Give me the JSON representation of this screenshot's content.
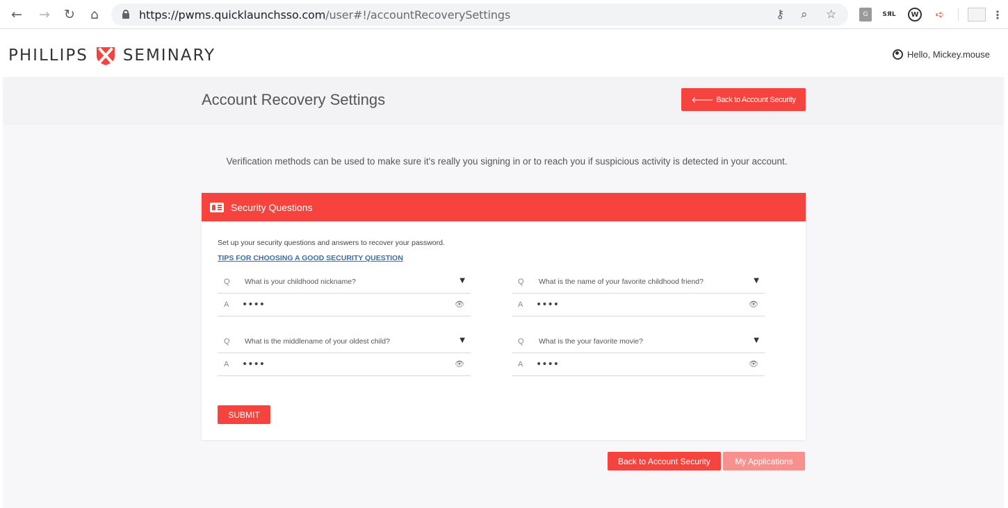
{
  "browser": {
    "url_host": "https://pwms.quicklaunchsso.com",
    "url_path": "/user#!/accountRecoverySettings",
    "nav_icons": [
      "back-arrow-icon",
      "forward-arrow-icon",
      "reload-icon",
      "home-icon"
    ],
    "omnibox_icons": [
      "key-icon",
      "zoom-icon",
      "star-icon"
    ],
    "extensions": [
      "G",
      "SЯL",
      "W"
    ]
  },
  "header": {
    "logo_left": "PHILLIPS",
    "logo_right": "SEMINARY",
    "greeting": "Hello, Mickey.mouse"
  },
  "page": {
    "title": "Account Recovery Settings",
    "back_top_label": "Back to Account Security",
    "intro": "Verification methods can be used to make sure it's really you signing in or to reach you if suspicious activity is detected in your account."
  },
  "card": {
    "title": "Security Questions",
    "description": "Set up your security questions and answers to recover your password.",
    "tips_link": "TIPS FOR CHOOSING A GOOD SECURITY QUESTION",
    "q_prefix": "Q",
    "a_prefix": "A",
    "questions": [
      {
        "question": "What is your childhood nickname?",
        "answer_mask": "••••"
      },
      {
        "question": "What is the name of your favorite childhood friend?",
        "answer_mask": "••••"
      },
      {
        "question": "What is the middlename of your oldest child?",
        "answer_mask": "••••"
      },
      {
        "question": "What is the your favorite movie?",
        "answer_mask": "••••"
      }
    ],
    "submit_label": "SUBMIT"
  },
  "footer_buttons": {
    "back_label": "Back to Account Security",
    "apps_label": "My Applications"
  },
  "colors": {
    "accent": "#f6433d",
    "accent_light": "#f8908d",
    "link": "#3b6ea5"
  }
}
